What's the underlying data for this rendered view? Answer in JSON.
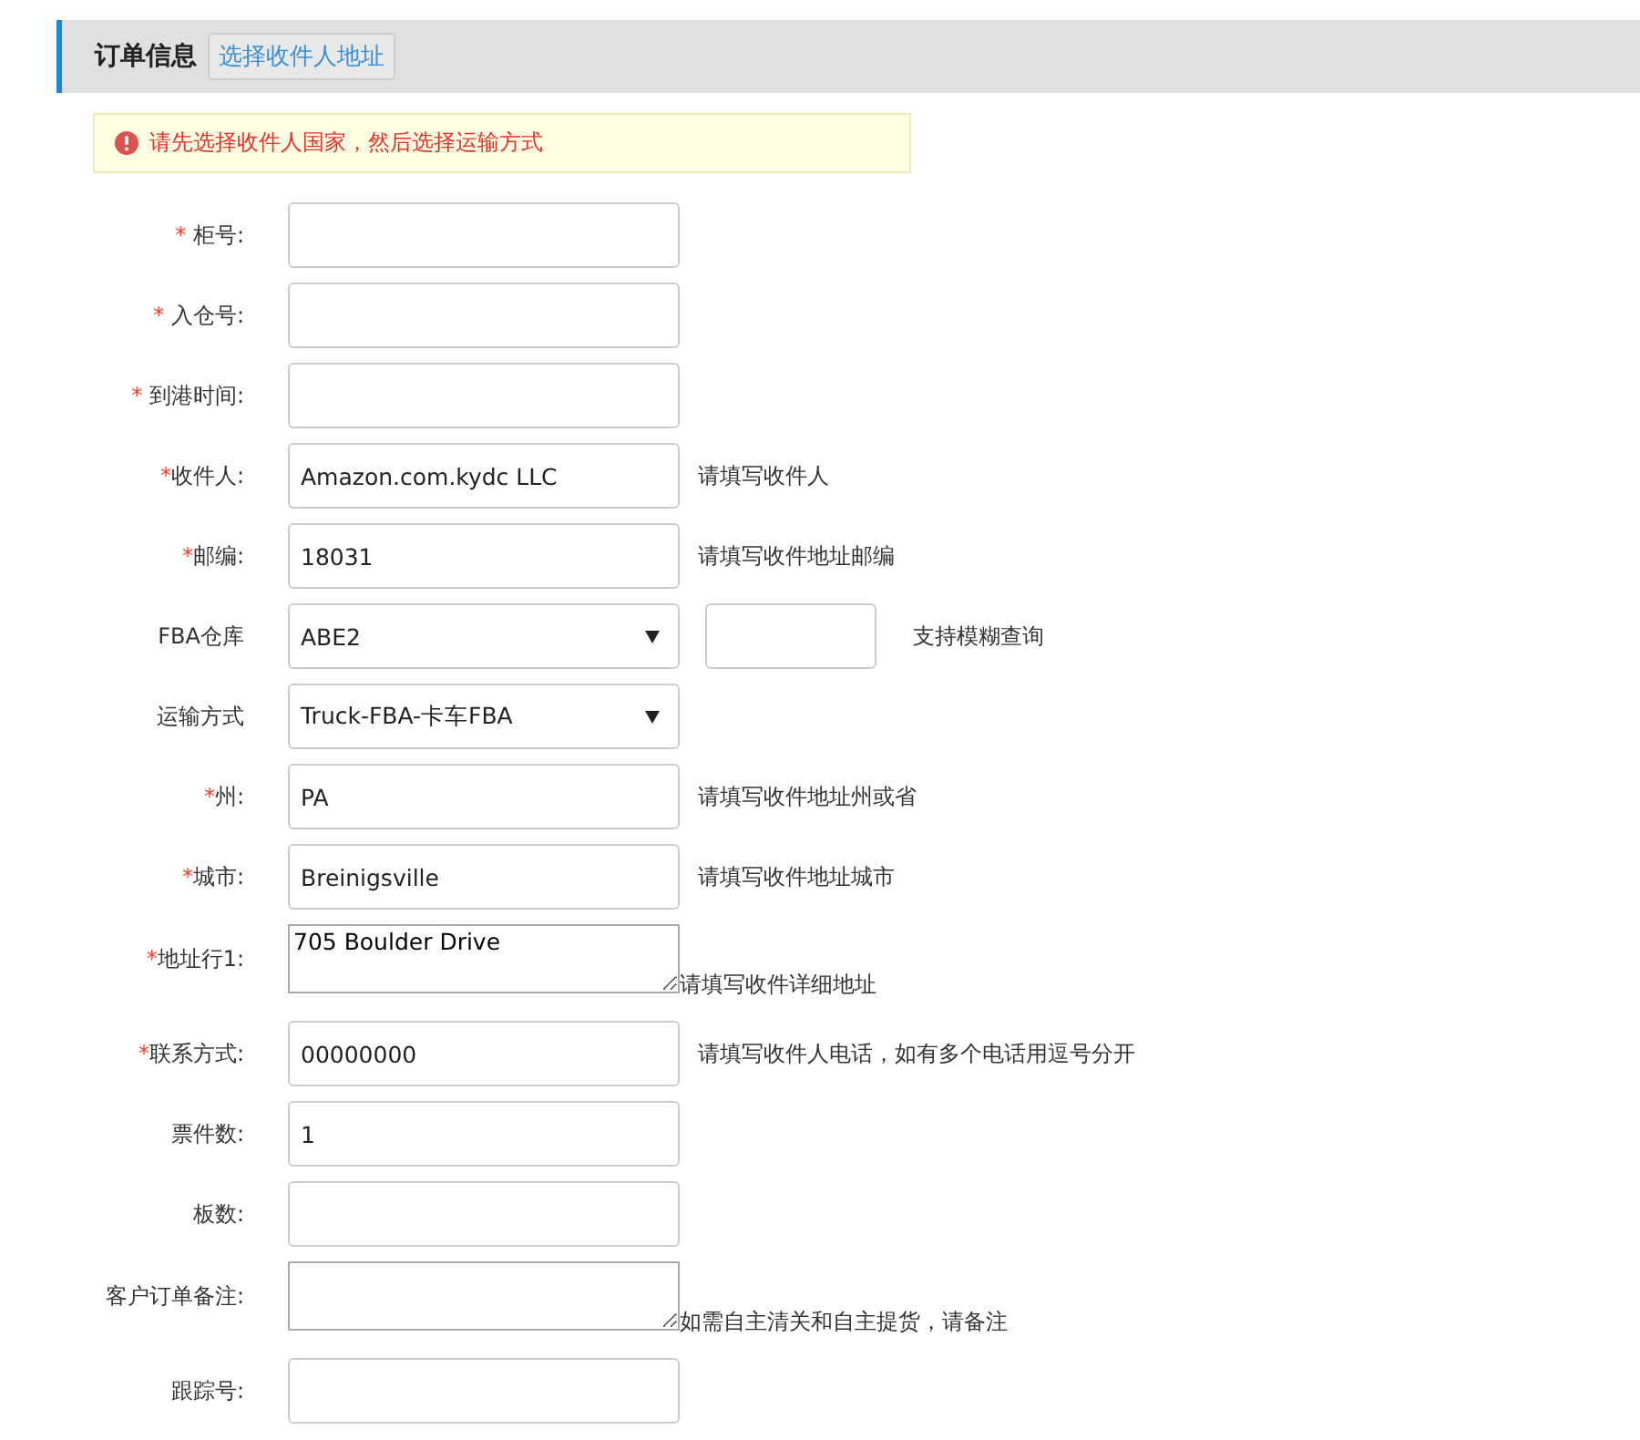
{
  "header": {
    "title": "订单信息",
    "address_button": "选择收件人地址"
  },
  "alert": {
    "message": "请先选择收件人国家，然后选择运输方式"
  },
  "fields": [
    {
      "kind": "input",
      "required_mark": "* ",
      "label": "柜号:"
    },
    {
      "kind": "input",
      "required_mark": "* ",
      "label": "入仓号:"
    },
    {
      "kind": "input",
      "required_mark": "* ",
      "label": "到港时间:"
    },
    {
      "kind": "input",
      "required_mark": "*",
      "label": "收件人:",
      "value": "Amazon.com.kydc LLC",
      "hint": "请填写收件人"
    },
    {
      "kind": "input",
      "required_mark": "*",
      "label": "邮编:",
      "value": "18031",
      "hint": "请填写收件地址邮编"
    },
    {
      "kind": "select",
      "label": "FBA仓库",
      "value": "ABE2",
      "search": true,
      "hint": "支持模糊查询"
    },
    {
      "kind": "select",
      "label": "运输方式",
      "value": "Truck-FBA-卡车FBA"
    },
    {
      "kind": "input",
      "required_mark": "*",
      "label": "州:",
      "value": "PA",
      "hint": "请填写收件地址州或省"
    },
    {
      "kind": "input",
      "required_mark": "*",
      "label": "城市:",
      "value": "Breinigsville",
      "hint": "请填写收件地址城市"
    },
    {
      "kind": "textarea",
      "required_mark": "*",
      "label": "地址行1:",
      "value": "705 Boulder Drive",
      "hint": "请填写收件详细地址"
    },
    {
      "kind": "input",
      "required_mark": "*",
      "label": "联系方式:",
      "value": "00000000",
      "hint": "请填写收件人电话，如有多个电话用逗号分开"
    },
    {
      "kind": "input",
      "label": "票件数:",
      "value": "1"
    },
    {
      "kind": "input",
      "label": "板数:"
    },
    {
      "kind": "textarea",
      "label": "客户订单备注:",
      "hint": "如需自主清关和自主提货，请备注"
    },
    {
      "kind": "input",
      "label": "跟踪号:"
    }
  ]
}
